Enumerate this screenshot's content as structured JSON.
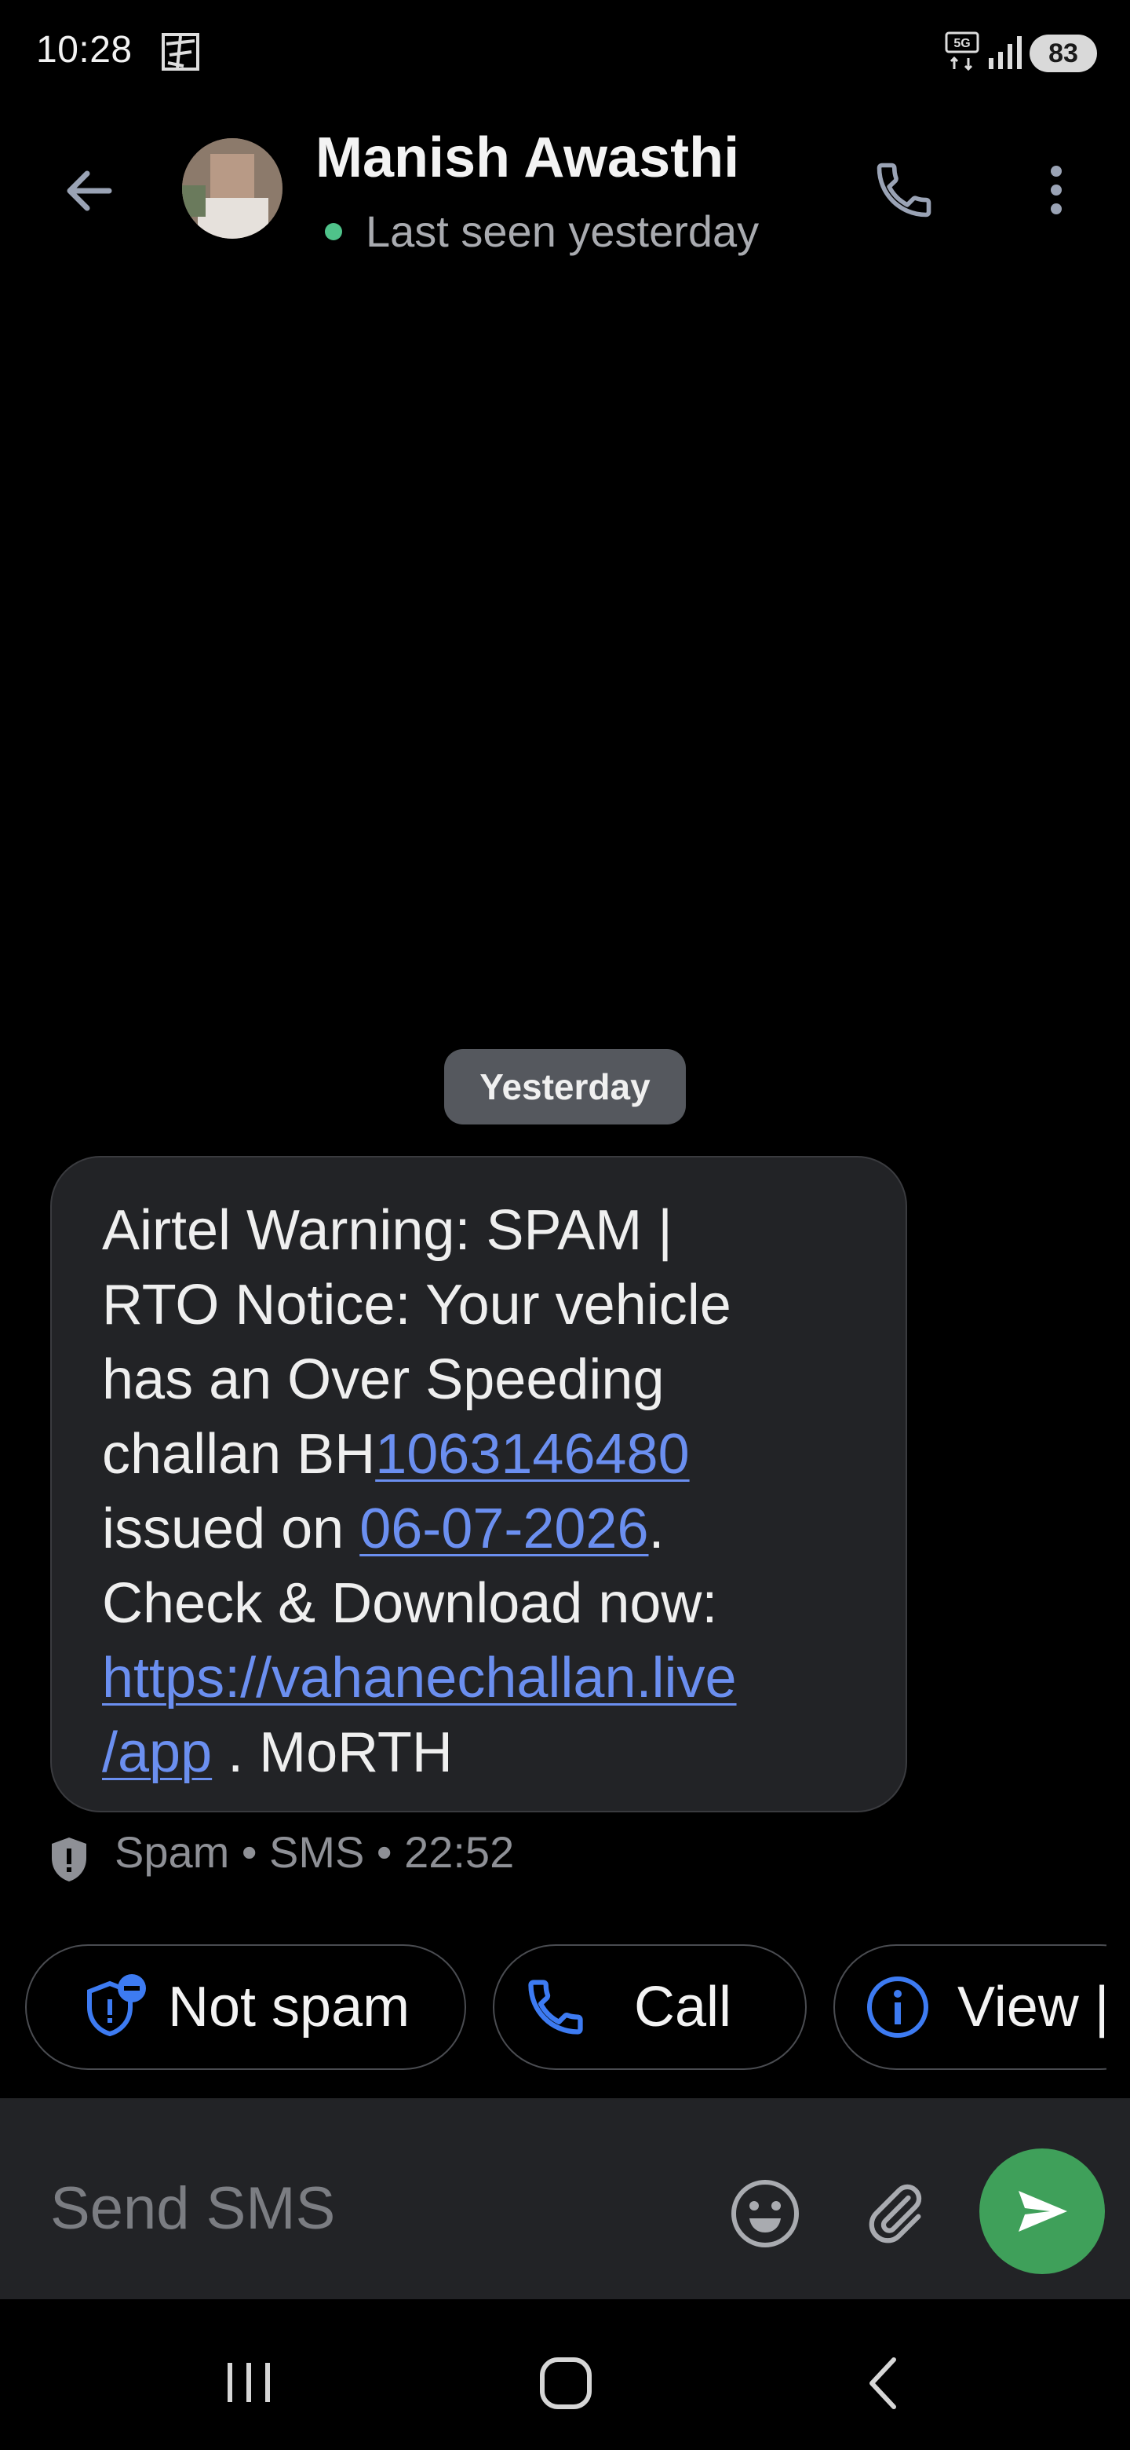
{
  "status_bar": {
    "time": "10:28",
    "network": "5G",
    "battery": "83",
    "notification_icon": "notification-icon",
    "signal_icon": "signal-icon"
  },
  "header": {
    "back_icon": "back-arrow-icon",
    "contact_name": "Manish Awasthi",
    "last_seen": "Last seen yesterday",
    "online_dot_color": "#4fc38a",
    "call_icon": "phone-icon",
    "more_icon": "more-options-icon"
  },
  "conversation": {
    "date_chip": "Yesterday",
    "message": {
      "line1": "Airtel Warning: SPAM |",
      "line2": "RTO Notice: Your vehicle",
      "line3": "has an Over Speeding",
      "line4_prefix": "challan BH",
      "challan_number": "1063146480",
      "issued_prefix": "issued on ",
      "issued_date": "06-07-2026",
      "issued_suffix": ".",
      "line6": "Check & Download now:",
      "link_part1": "https://vahanechallan.live",
      "link_part2": "/app",
      "suffix": " . MoRTH"
    },
    "meta": "Spam • SMS • 22:52",
    "meta_icon": "spam-shield-icon"
  },
  "suggestions": {
    "not_spam_label": "Not spam",
    "call_label": "Call",
    "view_label": "View |"
  },
  "composer": {
    "placeholder": "Send SMS",
    "emoji_icon": "emoji-icon",
    "attach_icon": "attachment-icon",
    "send_icon": "send-icon",
    "send_color": "#3fa05a"
  },
  "navigation": {
    "recents_icon": "recents-icon",
    "home_icon": "home-icon",
    "back_icon": "nav-back-icon"
  },
  "colors": {
    "background": "#000000",
    "bubble": "#222326",
    "link": "#6b8ff0",
    "accent_blue": "#3d7bf2"
  }
}
